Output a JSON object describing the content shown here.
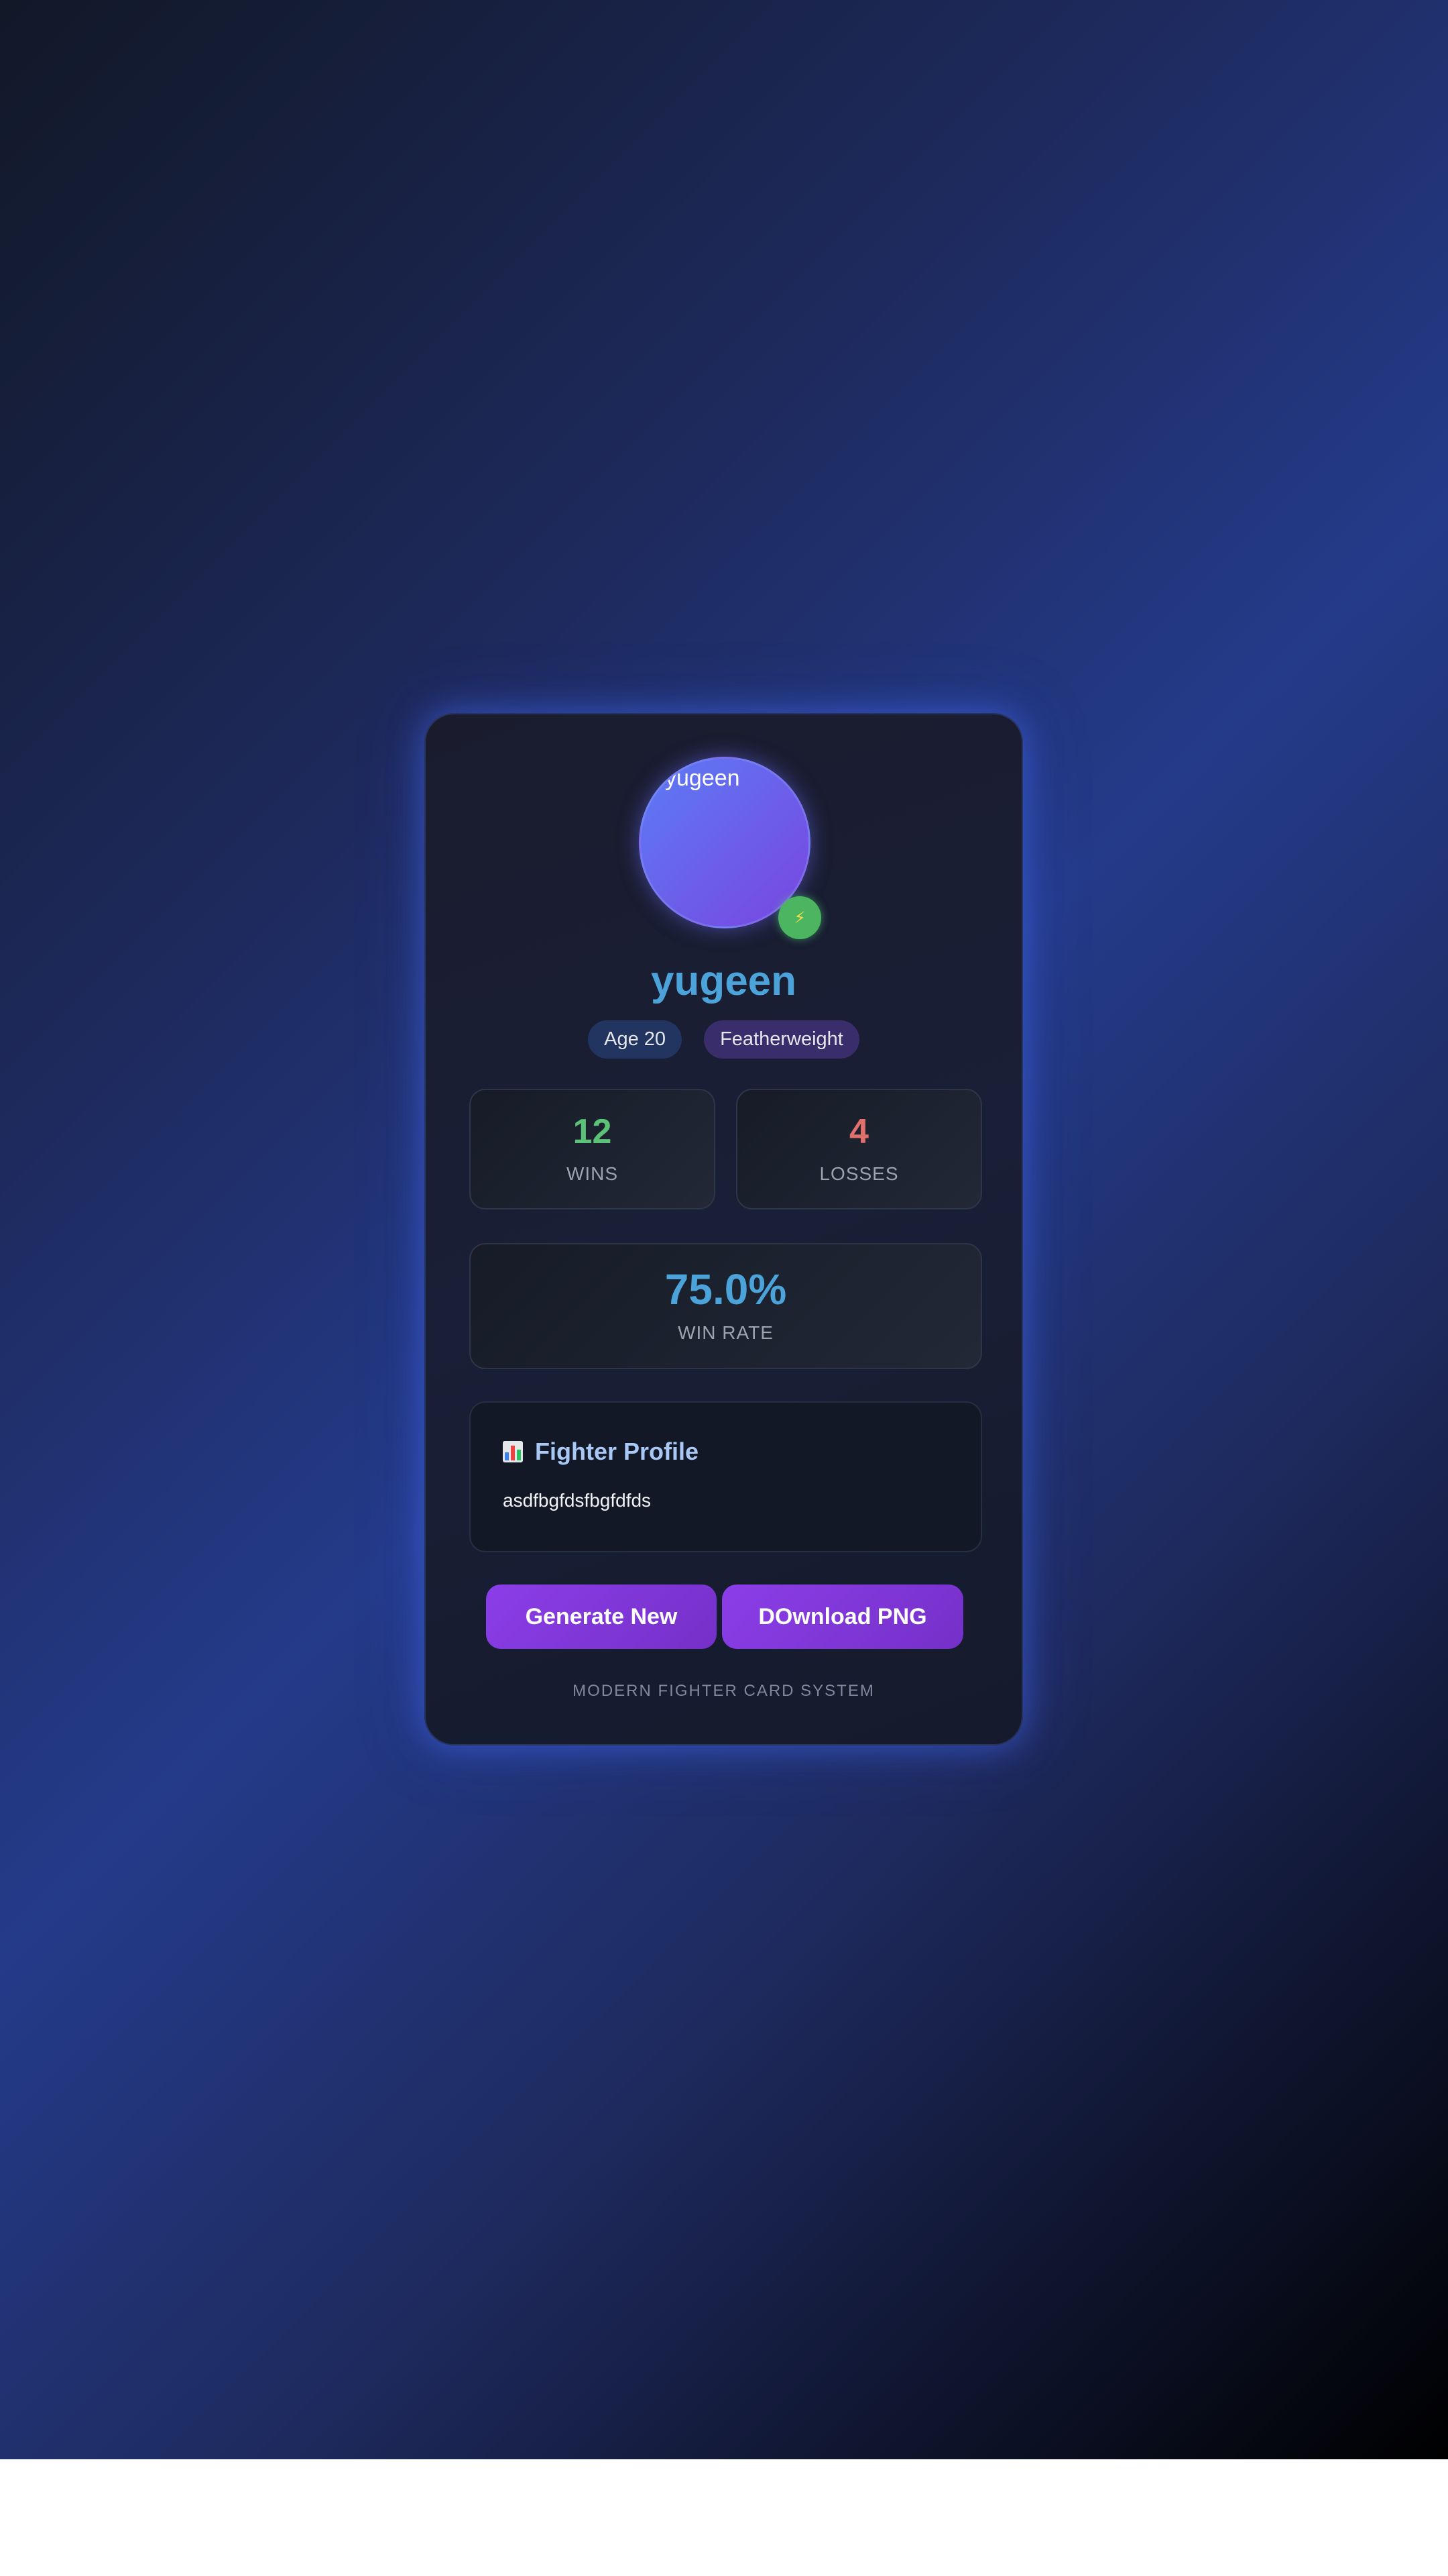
{
  "fighter": {
    "name": "yugeen",
    "avatar_alt": "yugeen",
    "status_icon": "⚡",
    "age_tag": "Age 20",
    "weight_class": "Featherweight"
  },
  "stats": {
    "wins": "12",
    "wins_label": "WINS",
    "losses": "4",
    "losses_label": "LOSSES",
    "win_rate": "75.0%",
    "win_rate_label": "WIN RATE"
  },
  "profile": {
    "icon": "bar-chart-icon",
    "title": "Fighter Profile",
    "text": "asdfbgfdsfbgfdfds"
  },
  "actions": {
    "generate_label": "Generate New",
    "download_label": "DOwnload PNG"
  },
  "footer": {
    "text": "MODERN FIGHTER CARD SYSTEM"
  },
  "colors": {
    "accent_blue": "#4ba3d9",
    "wins_green": "#5cc278",
    "losses_red": "#e0706b",
    "button_purple": "#8b3ee8",
    "status_green": "#4cb562"
  }
}
